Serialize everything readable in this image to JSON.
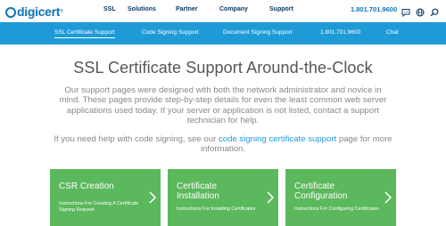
{
  "brand": {
    "name": "digicert",
    "reg": "®"
  },
  "main_nav": [
    "SSL",
    "Solutions",
    "Partner",
    "Company",
    "Support"
  ],
  "header_phone": "1.801.701.9600",
  "header_icons": [
    "chat-icon",
    "globe-icon",
    "search-icon"
  ],
  "sub_nav": {
    "items": [
      "SSL Certificate Support",
      "Code Signing Support",
      "Document Signing Support",
      "1.801.701.9600",
      "Chat"
    ],
    "active_index": 0
  },
  "hero": {
    "title": "SSL Certificate Support Around-the-Clock",
    "intro": "Our support pages were designed with both the network administrator and novice in mind. These pages provide step-by-step details for even the least common web server applications used today. If your server or application is not listed, contact a support technician for help.",
    "code_signing_prefix": "If you need help with code signing, see our ",
    "code_signing_link": "code signing certificate support",
    "code_signing_suffix": " page for more information."
  },
  "cards": [
    {
      "title": "CSR Creation",
      "description": "Instructions For Creating A Certificate Signing Request"
    },
    {
      "title": "Certificate Installation",
      "description": "Instructions For Installing Certificates"
    },
    {
      "title": "Certificate Configuration",
      "description": "Instructions For Configuring Certificates"
    }
  ],
  "colors": {
    "brand_blue": "#0e73b9",
    "subnav_blue": "#1e9bd7",
    "card_green": "#5cb85c",
    "nav_dark": "#0a3a66"
  }
}
